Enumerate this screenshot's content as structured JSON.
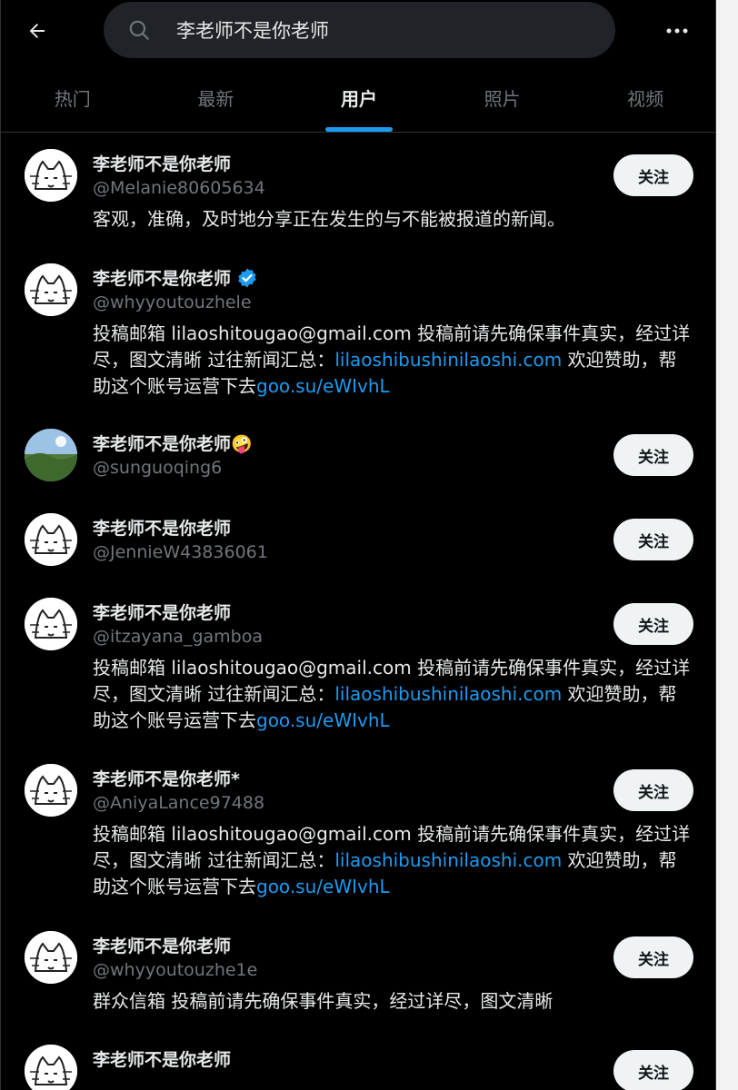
{
  "search": {
    "query": "李老师不是你老师"
  },
  "tabs": [
    {
      "label": "热门"
    },
    {
      "label": "最新"
    },
    {
      "label": "用户"
    },
    {
      "label": "照片"
    },
    {
      "label": "视频"
    }
  ],
  "users": [
    {
      "name": "李老师不是你老师",
      "handle": "@Melanie80605634",
      "follow": "关注",
      "bio": "客观，准确，及时地分享正在发生的与不能被报道的新闻。"
    },
    {
      "name": "李老师不是你老师",
      "handle": "@whyyoutouzhele",
      "bio_a": "投稿邮箱 lilaoshitougao@gmail.com 投稿前请先确保事件真实，经过详尽，图文清晰 过往新闻汇总：",
      "bio_link1": "lilaoshibushinilaoshi.com",
      "bio_b": " 欢迎赞助，帮助这个账号运营下去",
      "bio_link2": "goo.su/eWIvhL"
    },
    {
      "name": "李老师不是你老师🤪",
      "handle": "@sunguoqing6",
      "follow": "关注"
    },
    {
      "name": "李老师不是你老师",
      "handle": "@JennieW43836061",
      "follow": "关注"
    },
    {
      "name": "李老师不是你老师",
      "handle": "@itzayana_gamboa",
      "follow": "关注",
      "bio_a": "投稿邮箱 lilaoshitougao@gmail.com 投稿前请先确保事件真实，经过详尽，图文清晰 过往新闻汇总：",
      "bio_link1": "lilaoshibushinilaoshi.com",
      "bio_b": " 欢迎赞助，帮助这个账号运营下去",
      "bio_link2": "goo.su/eWIvhL"
    },
    {
      "name": "李老师不是你老师*",
      "handle": "@AniyaLance97488",
      "follow": "关注",
      "bio_a": "投稿邮箱 lilaoshitougao@gmail.com 投稿前请先确保事件真实，经过详尽，图文清晰 过往新闻汇总：",
      "bio_link1": "lilaoshibushinilaoshi.com",
      "bio_b": " 欢迎赞助，帮助这个账号运营下去",
      "bio_link2": "goo.su/eWIvhL"
    },
    {
      "name": "李老师不是你老师",
      "handle": "@whyyoutouzhe1e",
      "follow": "关注",
      "bio": "群众信箱 投稿前请先确保事件真实，经过详尽，图文清晰"
    },
    {
      "name": "李老师不是你老师",
      "follow": "关注"
    }
  ],
  "colors": {
    "accent": "#1d9bf0",
    "verified": "#1d9bf0",
    "muted": "#71767b"
  }
}
